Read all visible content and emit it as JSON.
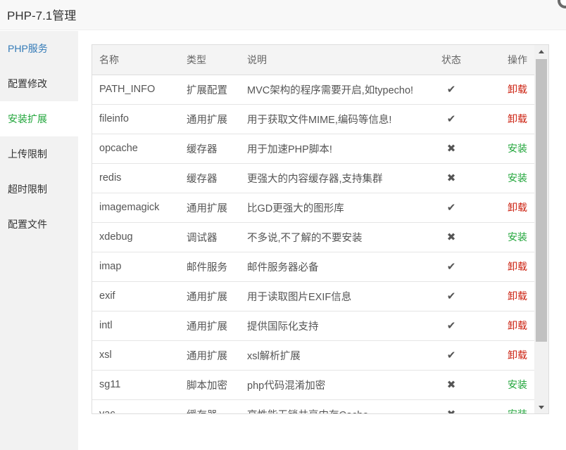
{
  "title": "PHP-7.1管理",
  "sidebar": {
    "items": [
      {
        "label": "PHP服务"
      },
      {
        "label": "配置修改"
      },
      {
        "label": "安装扩展"
      },
      {
        "label": "上传限制"
      },
      {
        "label": "超时限制"
      },
      {
        "label": "配置文件"
      }
    ],
    "active_index": 2
  },
  "table": {
    "headers": {
      "name": "名称",
      "type": "类型",
      "desc": "说明",
      "status": "状态",
      "op": "操作"
    },
    "rows": [
      {
        "name": "PATH_INFO",
        "type": "扩展配置",
        "desc": "MVC架构的程序需要开启,如typecho!",
        "status": "✔",
        "installed": true,
        "op": "卸载"
      },
      {
        "name": "fileinfo",
        "type": "通用扩展",
        "desc": "用于获取文件MIME,编码等信息!",
        "status": "✔",
        "installed": true,
        "op": "卸载"
      },
      {
        "name": "opcache",
        "type": "缓存器",
        "desc": "用于加速PHP脚本!",
        "status": "✖",
        "installed": false,
        "op": "安装"
      },
      {
        "name": "redis",
        "type": "缓存器",
        "desc": "更强大的内容缓存器,支持集群",
        "status": "✖",
        "installed": false,
        "op": "安装"
      },
      {
        "name": "imagemagick",
        "type": "通用扩展",
        "desc": "比GD更强大的图形库",
        "status": "✔",
        "installed": true,
        "op": "卸载"
      },
      {
        "name": "xdebug",
        "type": "调试器",
        "desc": "不多说,不了解的不要安装",
        "status": "✖",
        "installed": false,
        "op": "安装"
      },
      {
        "name": "imap",
        "type": "邮件服务",
        "desc": "邮件服务器必备",
        "status": "✔",
        "installed": true,
        "op": "卸载"
      },
      {
        "name": "exif",
        "type": "通用扩展",
        "desc": "用于读取图片EXIF信息",
        "status": "✔",
        "installed": true,
        "op": "卸载"
      },
      {
        "name": "intl",
        "type": "通用扩展",
        "desc": "提供国际化支持",
        "status": "✔",
        "installed": true,
        "op": "卸载"
      },
      {
        "name": "xsl",
        "type": "通用扩展",
        "desc": "xsl解析扩展",
        "status": "✔",
        "installed": true,
        "op": "卸载"
      },
      {
        "name": "sg11",
        "type": "脚本加密",
        "desc": "php代码混淆加密",
        "status": "✖",
        "installed": false,
        "op": "安装"
      },
      {
        "name": "yac",
        "type": "缓存器",
        "desc": "高性能无锁共享内存Cache",
        "status": "✖",
        "installed": false,
        "op": "安装"
      }
    ]
  },
  "colors": {
    "install": "#20a53a",
    "uninstall": "#cc2211",
    "active_menu": "#20a53a"
  }
}
